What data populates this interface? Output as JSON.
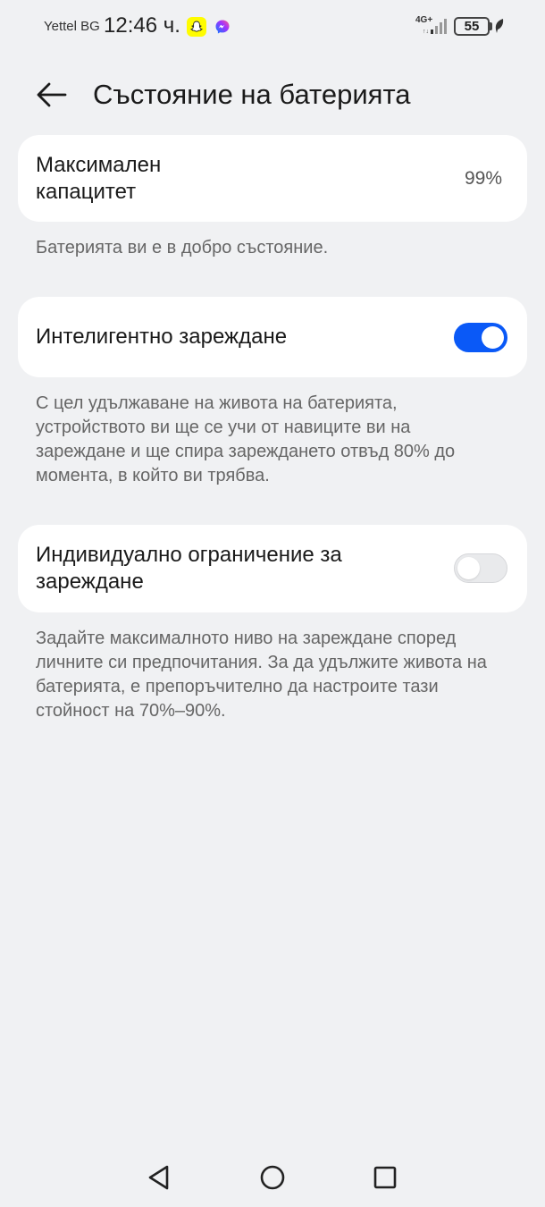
{
  "status_bar": {
    "carrier": "Yettel BG",
    "time": "12:46 ч.",
    "network": "4G+",
    "battery": "55",
    "icons": [
      "snapchat-icon",
      "messenger-icon",
      "signal-icon",
      "battery-icon",
      "leaf-icon"
    ]
  },
  "header": {
    "back_icon": "arrow-left-icon",
    "title": "Състояние на батерията"
  },
  "capacity": {
    "label": "Максимален капацитет",
    "value": "99%",
    "description": "Батерията ви е в добро състояние."
  },
  "smart_charging": {
    "label": "Интелигентно зареждане",
    "enabled": true,
    "description": "С цел удължаване на живота на батерията, устройството ви ще се учи от навиците ви на зареждане и ще спира зареждането отвъд 80% до момента, в който ви трябва."
  },
  "custom_limit": {
    "label": "Индивидуално ограничение за зареждане",
    "enabled": false,
    "description": "Задайте максималното ниво на зареждане според личните си предпочитания. За да удължите живота на батерията, е препоръчително да настроите тази стойност на 70%–90%."
  },
  "nav": {
    "icons": [
      "back-triangle-icon",
      "home-circle-icon",
      "recents-square-icon"
    ]
  },
  "colors": {
    "accent": "#0a59f7",
    "background": "#f0f1f3",
    "card": "#ffffff"
  }
}
